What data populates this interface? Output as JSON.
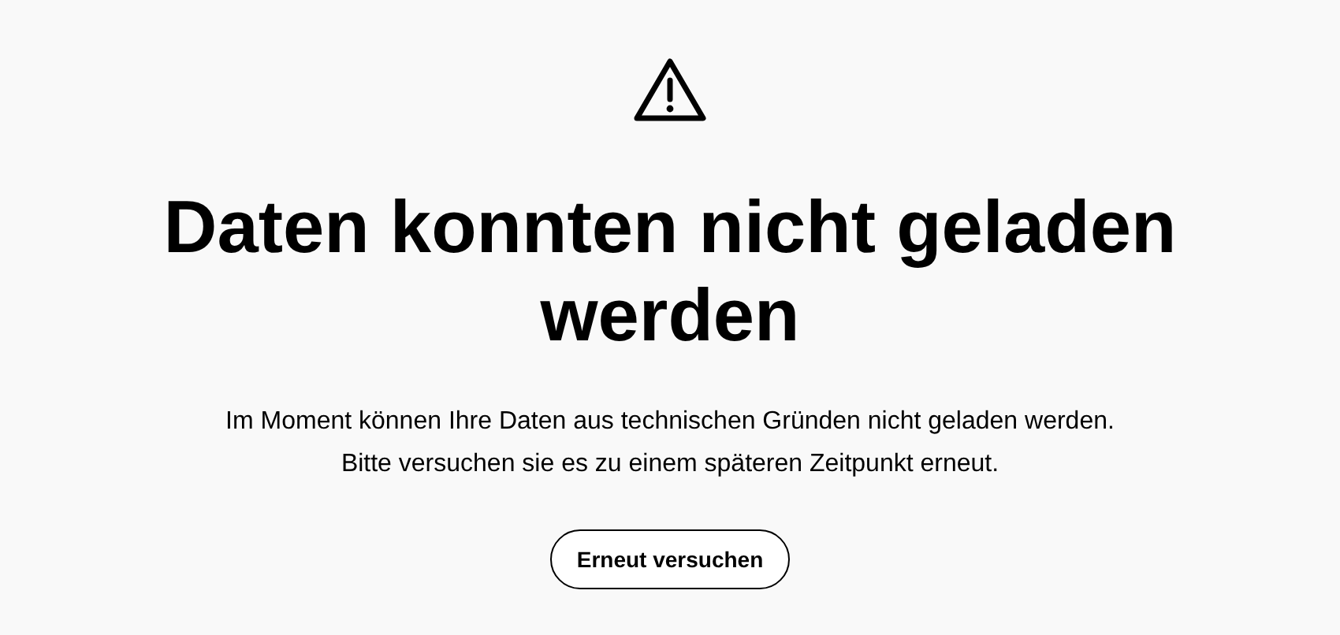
{
  "error": {
    "title": "Daten konnten nicht geladen werden",
    "message": "Im Moment können Ihre Daten aus technischen Gründen nicht geladen werden. Bitte versuchen sie es zu einem späteren Zeitpunkt erneut.",
    "button": "Erneut versuchen"
  }
}
